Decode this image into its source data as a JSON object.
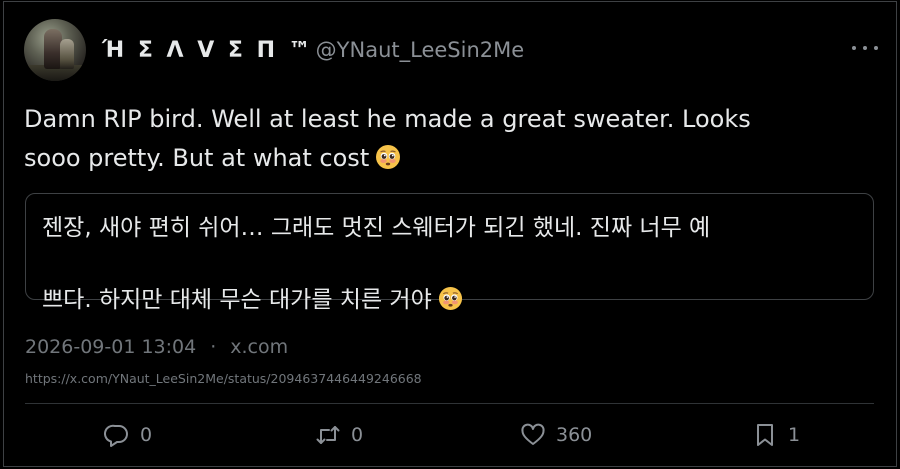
{
  "user": {
    "display_name": "Ή Σ Λ V Σ П ™",
    "handle": "@YNaut_LeeSin2Me"
  },
  "tweet": {
    "text_line1": "Damn RIP bird. Well at least he made a great sweater. Looks",
    "text_line2": "sooo pretty. But at what cost",
    "translation": "젠장, 새야 편히 쉬어… 그래도 멋진 스웨터가 되긴 했네. 진짜 너무 예\n쁘다. 하지만 대체 무슨 대가를 치른 거야"
  },
  "meta": {
    "datetime": "2026-09-01 13:04",
    "separator": "·",
    "source": "x.com",
    "url": "https://x.com/YNaut_LeeSin2Me/status/2094637446449246668"
  },
  "actions": {
    "reply_count": "0",
    "retweet_count": "0",
    "like_count": "360",
    "bookmark_count": "1"
  },
  "colors": {
    "background": "#000000",
    "text": "#e7e9ea",
    "muted": "#71767b",
    "border": "#3e4144",
    "emoji_face": "#f7c34a"
  },
  "icons": {
    "avatar": "user-avatar",
    "more": "more-options-icon",
    "emoji": "pleading-face-emoji",
    "reply": "reply-icon",
    "retweet": "retweet-icon",
    "like": "heart-icon",
    "bookmark": "bookmark-icon"
  }
}
